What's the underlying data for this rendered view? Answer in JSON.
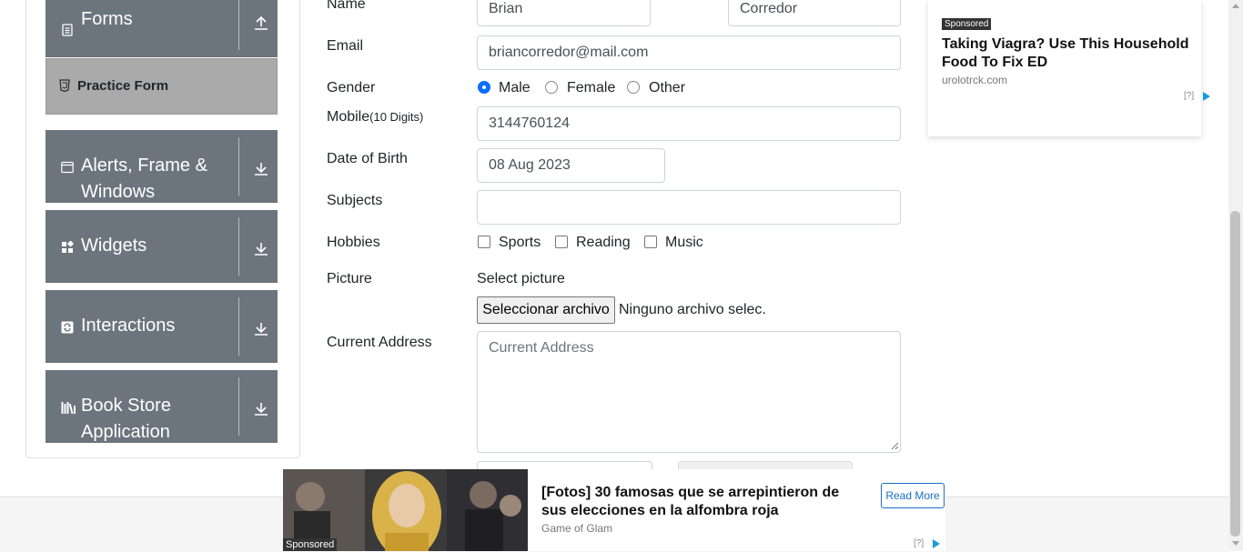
{
  "sidebar": {
    "groups": [
      {
        "label": "Forms",
        "icon": "document-icon",
        "arrow": "upload-arrow-icon"
      },
      {
        "label": "Alerts, Frame & Windows",
        "icon": "window-icon",
        "arrow": "download-arrow-icon"
      },
      {
        "label": "Widgets",
        "icon": "widgets-icon",
        "arrow": "download-arrow-icon"
      },
      {
        "label": "Interactions",
        "icon": "interactions-icon",
        "arrow": "download-arrow-icon"
      },
      {
        "label": "Book Store Application",
        "icon": "books-icon",
        "arrow": "download-arrow-icon"
      }
    ],
    "active_item": {
      "label": "Practice Form",
      "icon": "html5-icon"
    }
  },
  "form": {
    "name_label": "Name",
    "first_name": "Brian",
    "last_name": "Corredor",
    "email_label": "Email",
    "email": "briancorredor@mail.com",
    "gender_label": "Gender",
    "gender_options": [
      "Male",
      "Female",
      "Other"
    ],
    "gender_selected": "Male",
    "mobile_label": "Mobile",
    "mobile_hint": "(10 Digits)",
    "mobile": "3144760124",
    "dob_label": "Date of Birth",
    "dob": "08 Aug 2023",
    "subjects_label": "Subjects",
    "subjects": "",
    "hobbies_label": "Hobbies",
    "hobbies": [
      "Sports",
      "Reading",
      "Music"
    ],
    "picture_label": "Picture",
    "picture_hint": "Select picture",
    "file_button": "Seleccionar archivo",
    "file_status": "Ninguno archivo selec.",
    "address_label": "Current Address",
    "address_placeholder": "Current Address"
  },
  "ad_top": {
    "sponsored": "Sponsored",
    "title": "Taking Viagra? Use This Household Food To Fix ED",
    "source": "urolotrck.com",
    "info": "[?]"
  },
  "ad_bottom": {
    "sponsored": "Sponsored",
    "title": "[Fotos] 30 famosas que se arrepintieron de sus elecciones en la alfombra roja",
    "source": "Game of Glam",
    "cta": "Read More",
    "info": "[?]"
  },
  "colors": {
    "sidebar_group": "#6c757d",
    "active_item": "#aaaaaa",
    "accent": "#0d6efd",
    "ad_link": "#1a6fc4"
  }
}
